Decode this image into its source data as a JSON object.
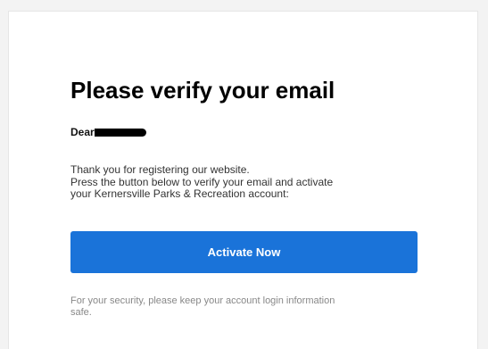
{
  "email": {
    "title": "Please verify your email",
    "greeting": "Dear",
    "body_lines": [
      "Thank you for registering our website.",
      "Press the button below to verify your email and activate",
      "your Kernersville Parks & Recreation account:"
    ],
    "button_label": "Activate Now",
    "security_lines": [
      "For your security, please keep your account login information",
      "safe."
    ]
  },
  "colors": {
    "accent": "#1a73d9",
    "background": "#f3f3f3",
    "card": "#ffffff"
  }
}
